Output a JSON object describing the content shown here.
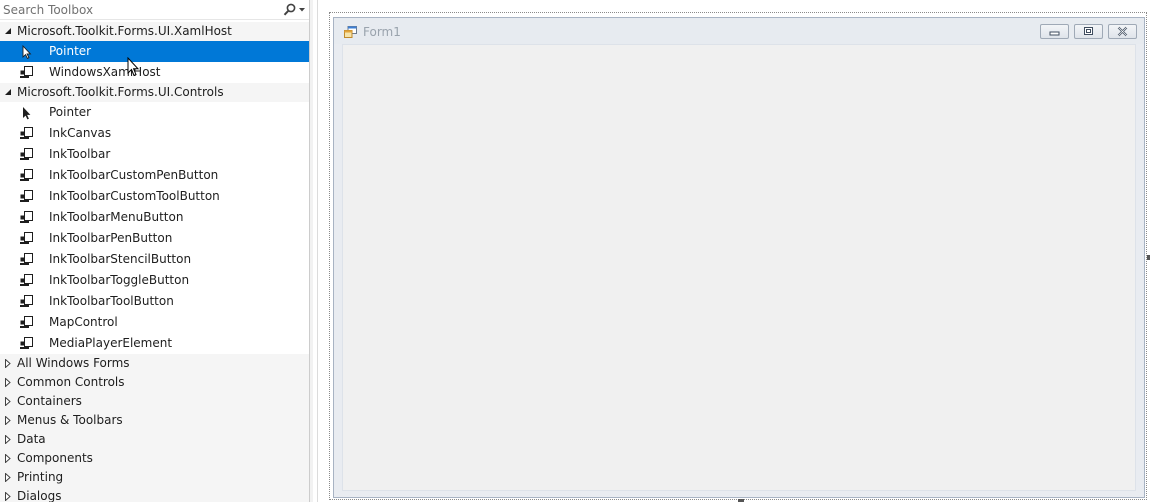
{
  "toolbox": {
    "search": {
      "placeholder": "Search Toolbox",
      "value": ""
    },
    "groups": [
      {
        "label": "Microsoft.Toolkit.Forms.UI.XamlHost",
        "expanded": true,
        "items": [
          {
            "label": "Pointer",
            "icon": "pointer-arrow-icon",
            "selected": true
          },
          {
            "label": "WindowsXamlHost",
            "icon": "component-icon"
          }
        ]
      },
      {
        "label": "Microsoft.Toolkit.Forms.UI.Controls",
        "expanded": true,
        "items": [
          {
            "label": "Pointer",
            "icon": "pointer-arrow-icon"
          },
          {
            "label": "InkCanvas",
            "icon": "component-icon"
          },
          {
            "label": "InkToolbar",
            "icon": "component-icon"
          },
          {
            "label": "InkToolbarCustomPenButton",
            "icon": "component-icon"
          },
          {
            "label": "InkToolbarCustomToolButton",
            "icon": "component-icon"
          },
          {
            "label": "InkToolbarMenuButton",
            "icon": "component-icon"
          },
          {
            "label": "InkToolbarPenButton",
            "icon": "component-icon"
          },
          {
            "label": "InkToolbarStencilButton",
            "icon": "component-icon"
          },
          {
            "label": "InkToolbarToggleButton",
            "icon": "component-icon"
          },
          {
            "label": "InkToolbarToolButton",
            "icon": "component-icon"
          },
          {
            "label": "MapControl",
            "icon": "component-icon"
          },
          {
            "label": "MediaPlayerElement",
            "icon": "component-icon"
          }
        ]
      },
      {
        "label": "All Windows Forms",
        "expanded": false
      },
      {
        "label": "Common Controls",
        "expanded": false
      },
      {
        "label": "Containers",
        "expanded": false
      },
      {
        "label": "Menus & Toolbars",
        "expanded": false
      },
      {
        "label": "Data",
        "expanded": false
      },
      {
        "label": "Components",
        "expanded": false
      },
      {
        "label": "Printing",
        "expanded": false
      },
      {
        "label": "Dialogs",
        "expanded": false
      }
    ]
  },
  "designer": {
    "form": {
      "title": "Form1",
      "icon": "form-icon",
      "buttons": [
        "minimize-icon",
        "maximize-icon",
        "close-icon"
      ]
    }
  },
  "colors": {
    "selection": "#0078d7",
    "group_header_bg": "#f5f5f5",
    "form_titlebar": "#e7ebf0",
    "form_client": "#f0f0f0",
    "title_text_inactive": "#9aa3ad"
  }
}
